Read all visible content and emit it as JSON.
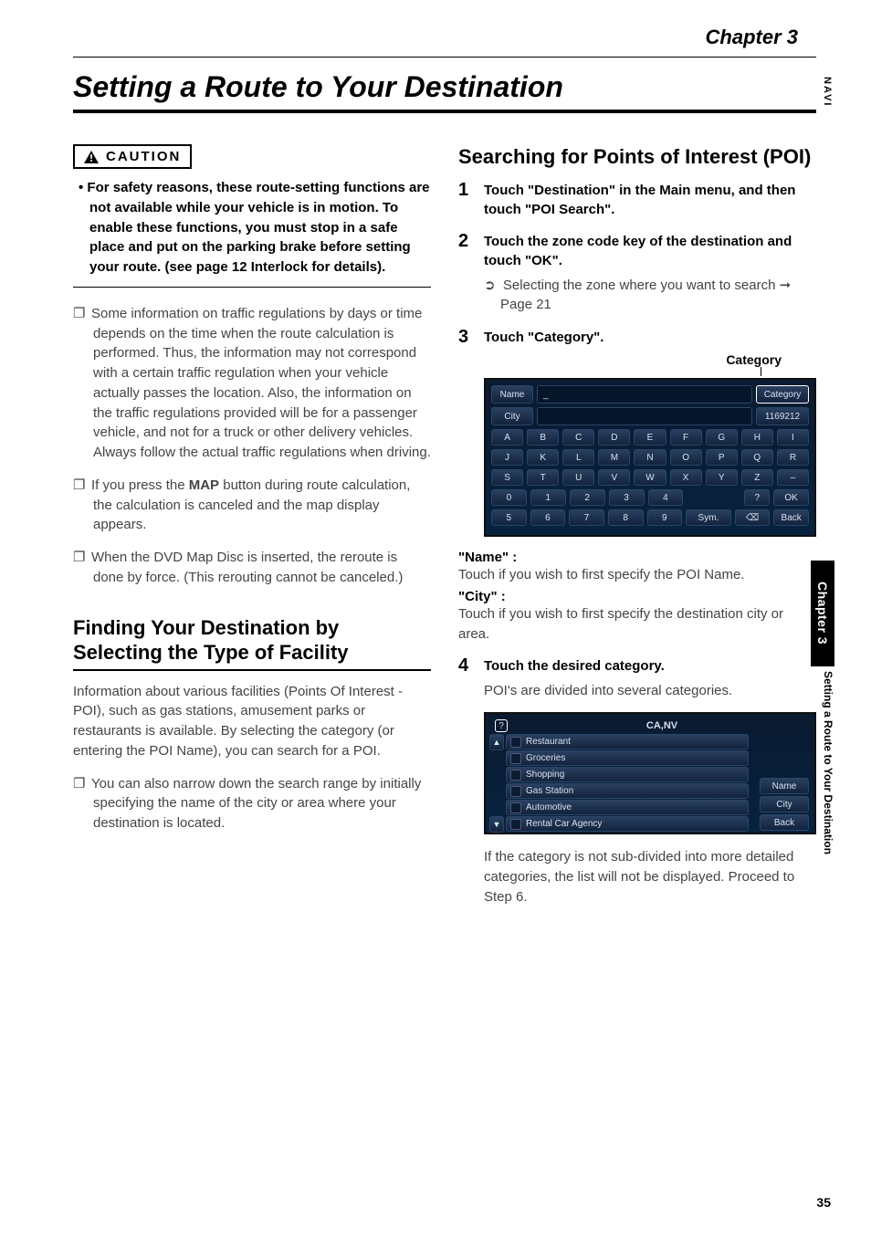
{
  "chapter_label": "Chapter 3",
  "page_title": "Setting a Route to Your Destination",
  "side": {
    "navi": "NAVI",
    "tab": "Chapter 3",
    "running": "Setting a Route to Your Destination"
  },
  "caution": {
    "header": "CAUTION",
    "text": "For safety reasons, these route-setting functions are not available while your vehicle is in motion. To enable these functions, you must stop in a safe place and put on the parking brake before setting your route. (see page 12 Interlock for details)."
  },
  "left_notes": [
    "Some information on traffic regulations by days or time depends on the time when the route calculation is performed. Thus, the information may not correspond with a certain traffic regulation when your vehicle actually passes the location. Also, the information on the traffic regulations provided will be for a passenger vehicle, and not for a truck or other delivery vehicles. Always follow the actual traffic regulations when driving.",
    "If you press the MAP button during route calculation, the calculation is canceled and the map display appears.",
    "When the DVD Map Disc is inserted, the reroute is done by force. (This rerouting cannot be canceled.)"
  ],
  "map_bold": "MAP",
  "section_finding": {
    "title": "Finding Your Destination by Selecting the Type of Facility",
    "intro": "Information about various facilities (Points Of Interest - POI), such as gas stations, amusement parks or restaurants is available. By selecting the category (or entering the POI Name), you can search for a POI.",
    "note": "You can also narrow down the search range by initially specifying the name of the city or area where your destination is located."
  },
  "section_poi": {
    "title": "Searching for Points of Interest (POI)",
    "step1": "Touch \"Destination\" in the Main menu, and then touch \"POI Search\".",
    "step2": "Touch the zone code key of the destination and touch \"OK\".",
    "step2_sub_prefix": "➲",
    "step2_sub": "Selecting the zone where you want to search ➞ Page 21",
    "step3": "Touch \"Category\".",
    "category_label": "Category",
    "name_label": "\"Name\" :",
    "name_text": "Touch if you wish to first specify the POI Name.",
    "city_label": "\"City\" :",
    "city_text": "Touch if you wish to first specify the destination city or area.",
    "step4": "Touch the desired category.",
    "step4_sub": "POI's are divided into several categories.",
    "step4_after": "If the category is not sub-divided into more detailed categories, the list will not be displayed. Proceed to Step 6."
  },
  "screen1": {
    "name_label": "Name",
    "city_label": "City",
    "name_value": "_",
    "category_btn": "Category",
    "count": "1169212",
    "rows": [
      [
        "A",
        "B",
        "C",
        "D",
        "E",
        "F",
        "G",
        "H",
        "I"
      ],
      [
        "J",
        "K",
        "L",
        "M",
        "N",
        "O",
        "P",
        "Q",
        "R"
      ],
      [
        "S",
        "T",
        "U",
        "V",
        "W",
        "X",
        "Y",
        "Z",
        "–"
      ]
    ],
    "numrow1": [
      "0",
      "1",
      "2",
      "3",
      "4"
    ],
    "help": "?",
    "ok": "OK",
    "numrow2": [
      "5",
      "6",
      "7",
      "8",
      "9"
    ],
    "sym": "Sym.",
    "del": "⌫",
    "back": "Back"
  },
  "screen2": {
    "help": "?",
    "title": "CA,NV",
    "items": [
      "Restaurant",
      "Groceries",
      "Shopping",
      "Gas Station",
      "Automotive",
      "Rental Car Agency"
    ],
    "side": [
      "Name",
      "City",
      "Back"
    ]
  },
  "page_number": "35"
}
